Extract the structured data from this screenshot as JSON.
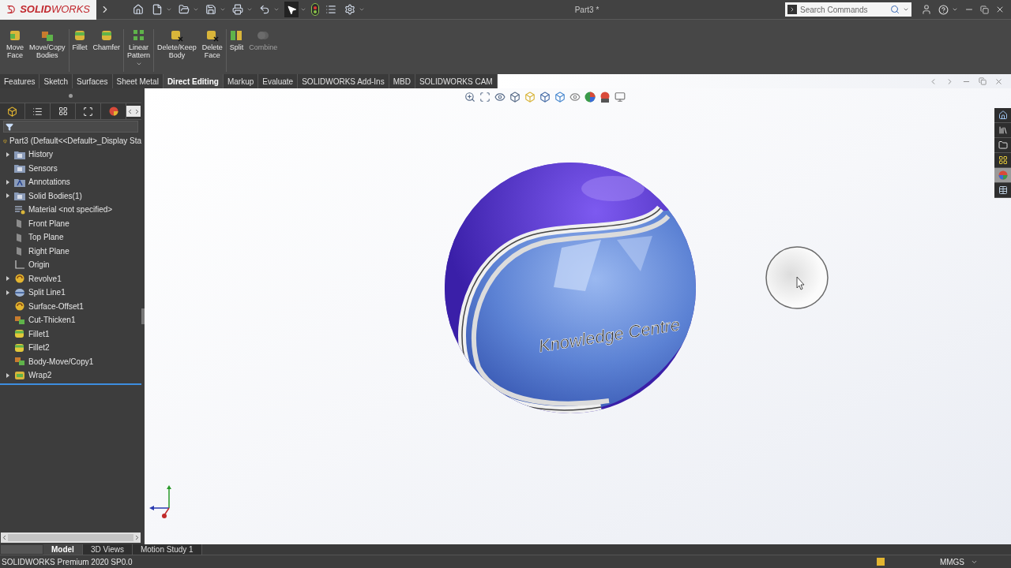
{
  "title_bar": {
    "logo": "**SOLID**WORKS",
    "document_title": "Part3 *",
    "search": {
      "placeholder": "Search Commands"
    }
  },
  "ribbon": {
    "groups": [
      [
        {
          "kind": "move-face",
          "label": "Move\nFace",
          "disabled": false,
          "dropdown": false
        },
        {
          "kind": "move-copy",
          "label": "Move/Copy\nBodies",
          "disabled": false,
          "dropdown": false
        }
      ],
      [
        {
          "kind": "fillet",
          "label": "Fillet",
          "disabled": false,
          "dropdown": false
        },
        {
          "kind": "chamfer",
          "label": "Chamfer",
          "disabled": false,
          "dropdown": false
        }
      ],
      [
        {
          "kind": "pattern",
          "label": "Linear\nPattern",
          "disabled": false,
          "dropdown": true
        }
      ],
      [
        {
          "kind": "delete-keep",
          "label": "Delete/Keep\nBody",
          "disabled": false,
          "dropdown": false
        },
        {
          "kind": "delete-face",
          "label": "Delete\nFace",
          "disabled": false,
          "dropdown": false
        }
      ],
      [
        {
          "kind": "split",
          "label": "Split",
          "disabled": false,
          "dropdown": false
        },
        {
          "kind": "combine",
          "label": "Combine",
          "disabled": true,
          "dropdown": false
        }
      ]
    ]
  },
  "command_tabs": [
    {
      "label": "Features",
      "selected": false
    },
    {
      "label": "Sketch",
      "selected": false
    },
    {
      "label": "Surfaces",
      "selected": false
    },
    {
      "label": "Sheet Metal",
      "selected": false
    },
    {
      "label": "Direct Editing",
      "selected": true
    },
    {
      "label": "Markup",
      "selected": false
    },
    {
      "label": "Evaluate",
      "selected": false
    },
    {
      "label": "SOLIDWORKS Add-Ins",
      "selected": false
    },
    {
      "label": "MBD",
      "selected": false
    },
    {
      "label": "SOLIDWORKS CAM",
      "selected": false
    }
  ],
  "feature_tree": {
    "root": "Part3  (Default<<Default>_Display Sta",
    "items": [
      {
        "label": "History",
        "kind": "folder",
        "collapsed": true
      },
      {
        "label": "Sensors",
        "kind": "folder",
        "collapsed": false
      },
      {
        "label": "Annotations",
        "kind": "annotation",
        "collapsed": true
      },
      {
        "label": "Solid Bodies(1)",
        "kind": "folder",
        "collapsed": true
      },
      {
        "label": "Material <not specified>",
        "kind": "material",
        "collapsed": false
      },
      {
        "label": "Front Plane",
        "kind": "plane",
        "collapsed": false
      },
      {
        "label": "Top Plane",
        "kind": "plane",
        "collapsed": false
      },
      {
        "label": "Right Plane",
        "kind": "plane",
        "collapsed": false
      },
      {
        "label": "Origin",
        "kind": "origin",
        "collapsed": false
      },
      {
        "label": "Revolve1",
        "kind": "feature",
        "collapsed": true
      },
      {
        "label": "Split Line1",
        "kind": "split",
        "collapsed": true
      },
      {
        "label": "Surface-Offset1",
        "kind": "feature",
        "collapsed": false
      },
      {
        "label": "Cut-Thicken1",
        "kind": "body",
        "collapsed": false
      },
      {
        "label": "Fillet1",
        "kind": "fillet",
        "collapsed": false
      },
      {
        "label": "Fillet2",
        "kind": "fillet",
        "collapsed": false
      },
      {
        "label": "Body-Move/Copy1",
        "kind": "body",
        "collapsed": false
      },
      {
        "label": "Wrap2",
        "kind": "wrap",
        "collapsed": true
      }
    ]
  },
  "viewport": {
    "model_text": "Knowledge Centre"
  },
  "task_pane": [
    {
      "kind": "home",
      "selected": false
    },
    {
      "kind": "library",
      "selected": false
    },
    {
      "kind": "folder",
      "selected": false
    },
    {
      "kind": "palette",
      "selected": false
    },
    {
      "kind": "appearance",
      "selected": true
    },
    {
      "kind": "properties",
      "selected": false
    }
  ],
  "bottom_tabs": [
    {
      "label": "Model",
      "selected": true
    },
    {
      "label": "3D Views",
      "selected": false
    },
    {
      "label": "Motion Study 1",
      "selected": false
    }
  ],
  "status_bar": {
    "product": "SOLIDWORKS Premium 2020 SP0.0",
    "units": "MMGS"
  }
}
